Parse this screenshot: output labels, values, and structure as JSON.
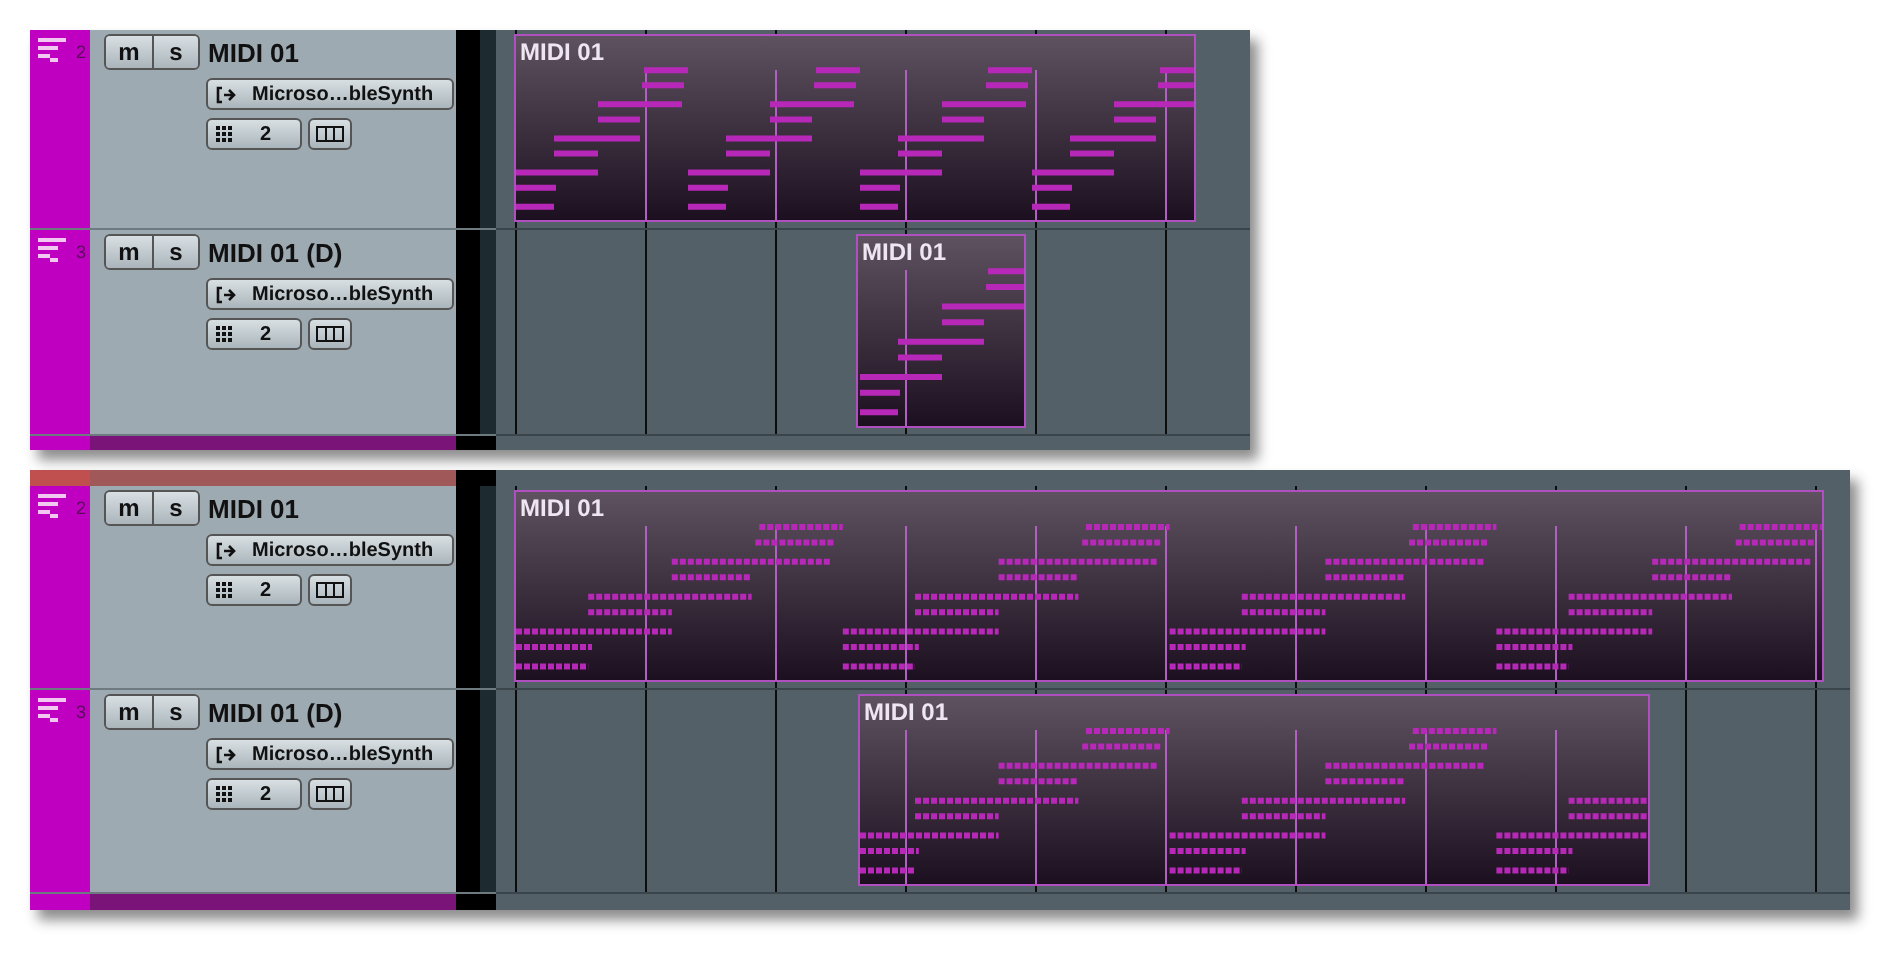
{
  "panels": [
    {
      "tracks": [
        {
          "number": "2",
          "name": "MIDI 01",
          "mute": "m",
          "solo": "s",
          "output": "Microso…bleSynth",
          "channel": "2",
          "parts": [
            {
              "title": "MIDI 01"
            }
          ]
        },
        {
          "number": "3",
          "name": "MIDI 01 (D)",
          "mute": "m",
          "solo": "s",
          "output": "Microso…bleSynth",
          "channel": "2",
          "parts": [
            {
              "title": "MIDI 01"
            }
          ]
        }
      ]
    },
    {
      "tracks": [
        {
          "number": "2",
          "name": "MIDI 01",
          "mute": "m",
          "solo": "s",
          "output": "Microso…bleSynth",
          "channel": "2",
          "parts": [
            {
              "title": "MIDI 01"
            }
          ]
        },
        {
          "number": "3",
          "name": "MIDI 01 (D)",
          "mute": "m",
          "solo": "s",
          "output": "Microso…bleSynth",
          "channel": "2",
          "parts": [
            {
              "title": "MIDI 01"
            }
          ]
        }
      ]
    }
  ]
}
